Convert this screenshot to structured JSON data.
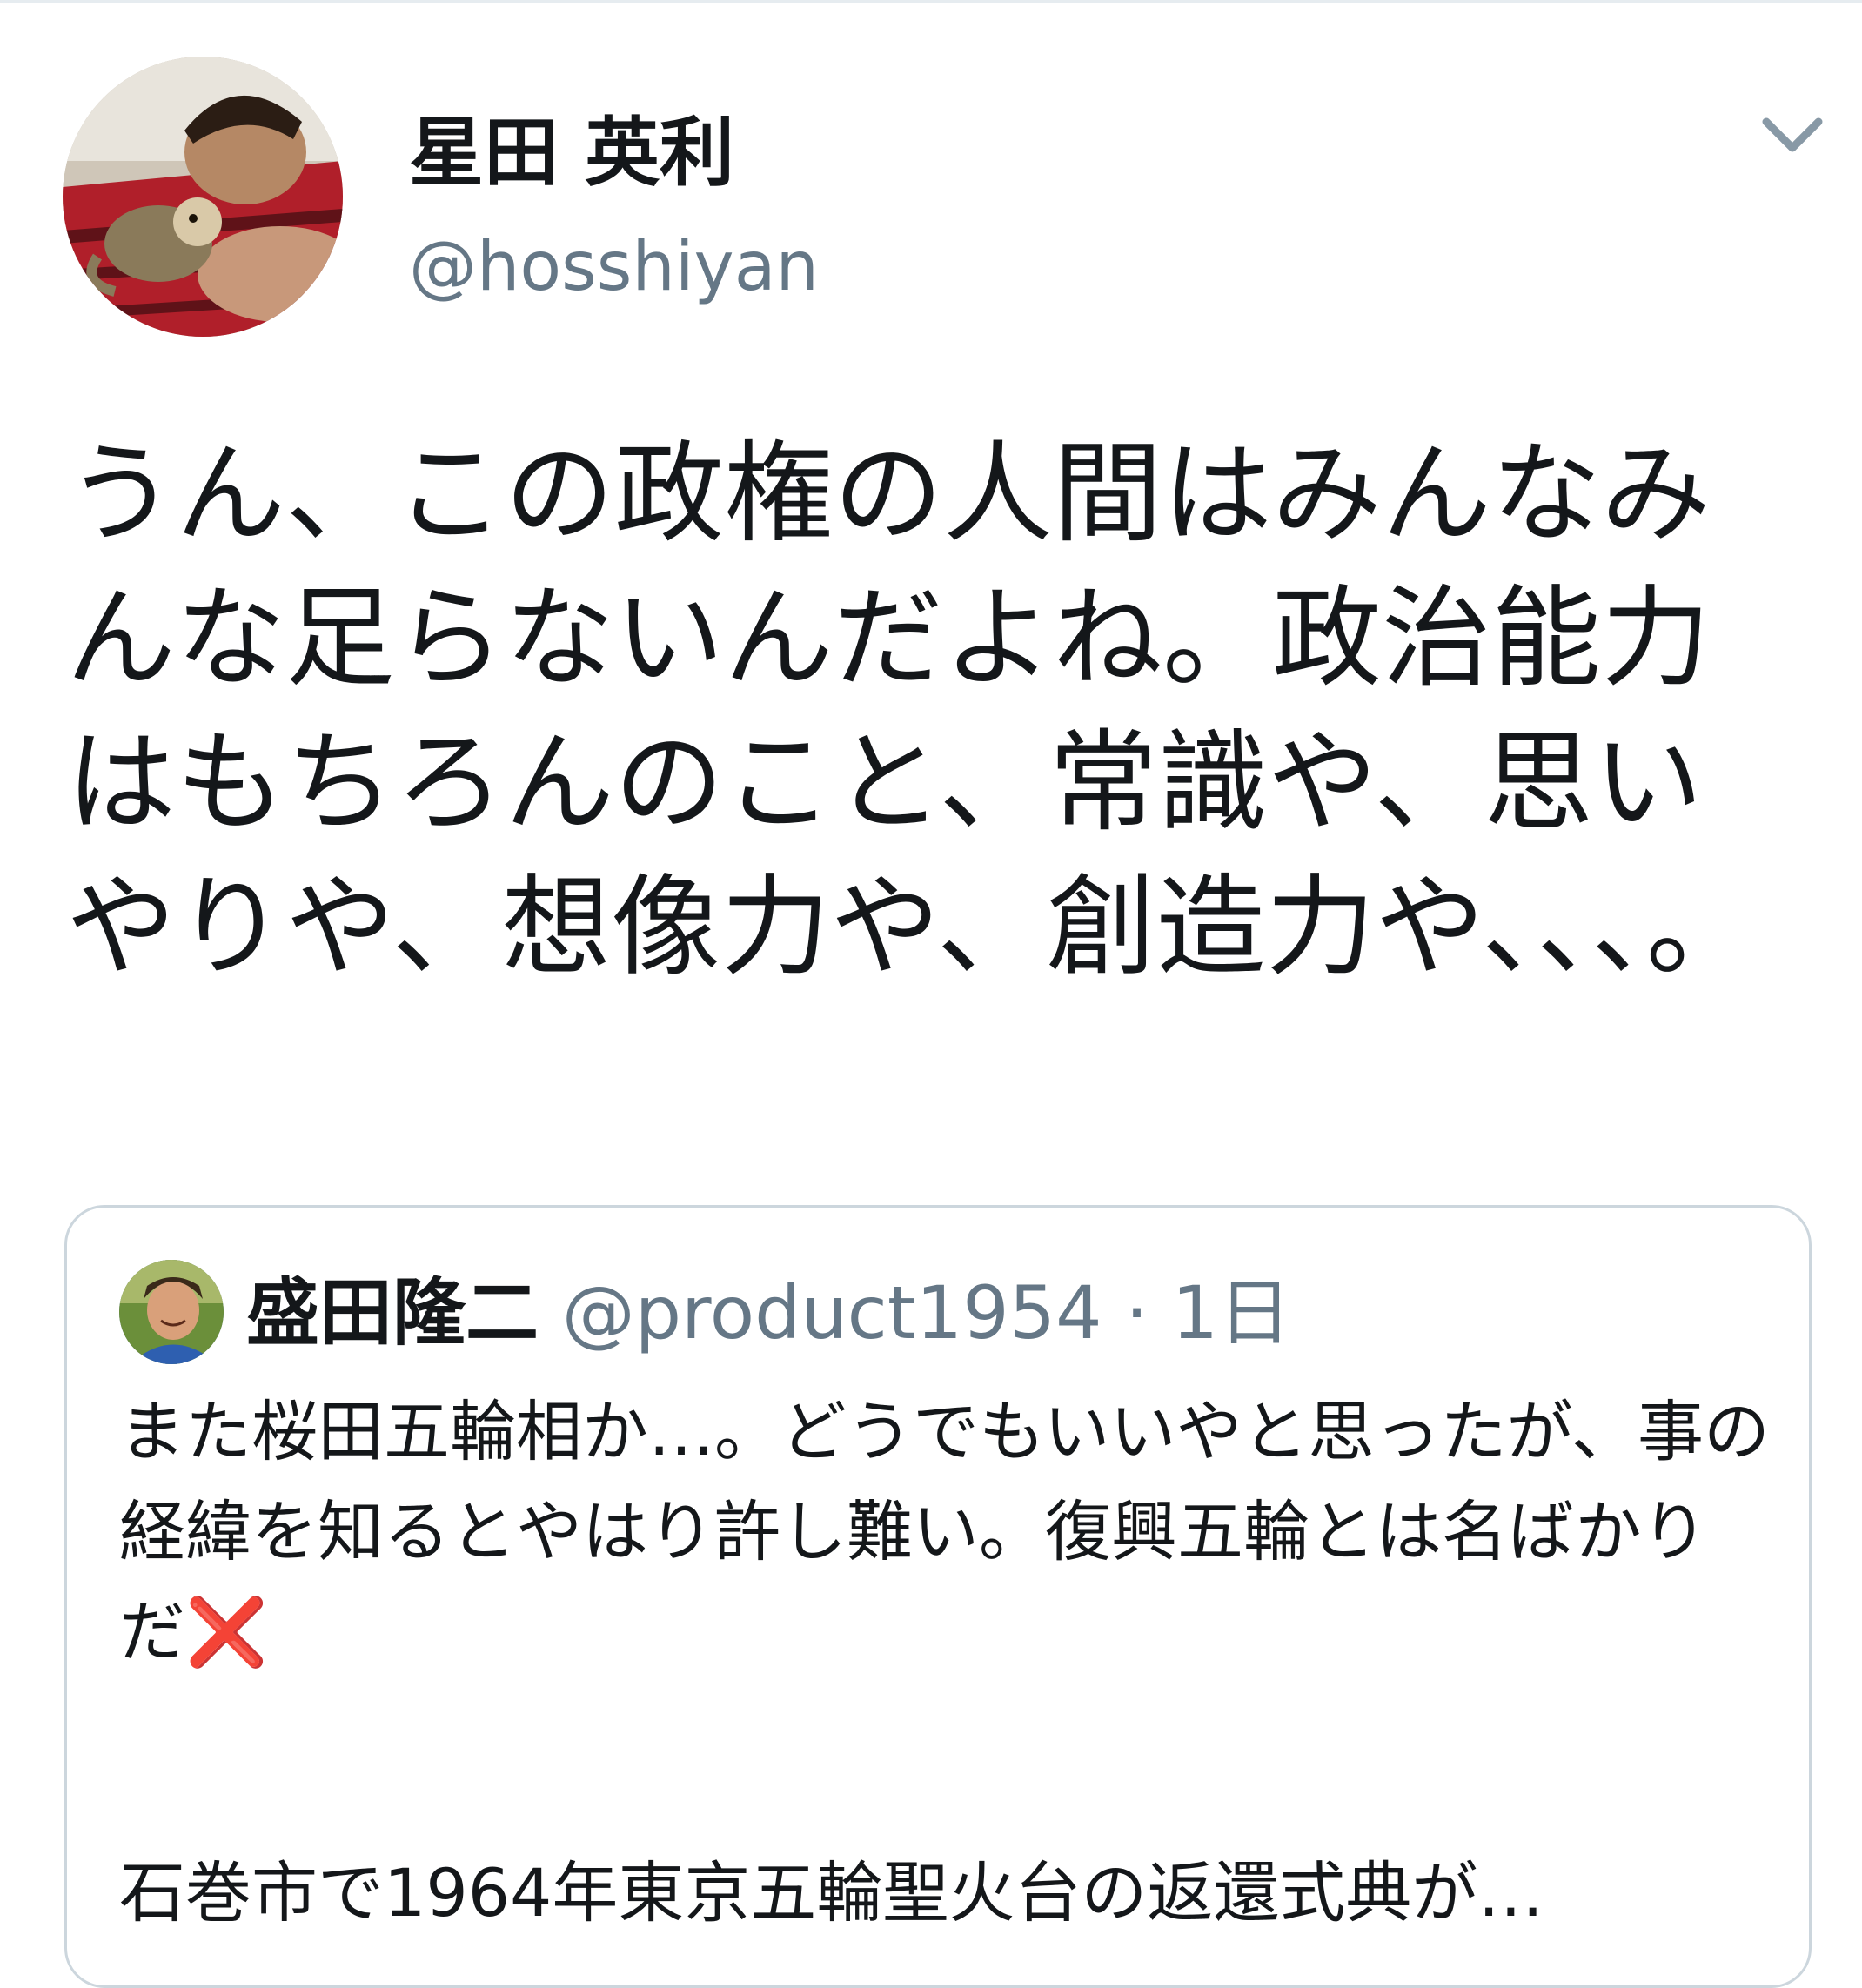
{
  "tweet": {
    "author": {
      "display_name": "星田 英利",
      "handle": "@hosshiyan",
      "avatar_icon": "user-avatar-photo"
    },
    "menu_icon": "chevron-down-icon",
    "text": "うん、この政権の人間はみんなみんな足らないんだよね。政治能力はもちろんのこと、常識や、思いやりや、想像力や、創造力や、、、。"
  },
  "quoted_tweet": {
    "author": {
      "display_name": "盛田隆二",
      "handle": "@product1954",
      "separator": "·",
      "time": "1日"
    },
    "text_line": "また桜田五輪相か…。どうでもいいやと思ったが、事の経緯を知るとやはり許し難い。復興五輪とは名ばかりだ",
    "emoji": "❌",
    "text_line_2": "石巻市で1964年東京五輪聖火台の返還式典が…"
  },
  "colors": {
    "text_primary": "#14171a",
    "text_secondary": "#657786",
    "border": "#ccd6dd",
    "emoji_red": "#e0245e"
  }
}
